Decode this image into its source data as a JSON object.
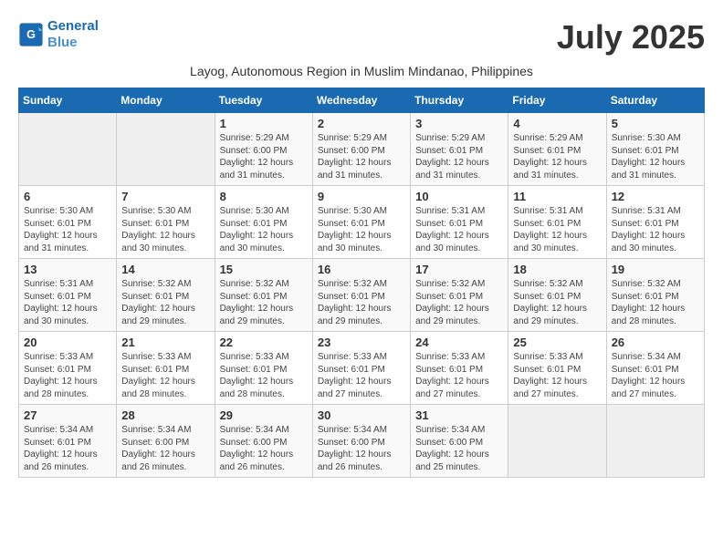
{
  "header": {
    "logo_line1": "General",
    "logo_line2": "Blue",
    "month_year": "July 2025",
    "subtitle": "Layog, Autonomous Region in Muslim Mindanao, Philippines"
  },
  "weekdays": [
    "Sunday",
    "Monday",
    "Tuesday",
    "Wednesday",
    "Thursday",
    "Friday",
    "Saturday"
  ],
  "weeks": [
    [
      {
        "day": "",
        "info": ""
      },
      {
        "day": "",
        "info": ""
      },
      {
        "day": "1",
        "info": "Sunrise: 5:29 AM\nSunset: 6:00 PM\nDaylight: 12 hours and 31 minutes."
      },
      {
        "day": "2",
        "info": "Sunrise: 5:29 AM\nSunset: 6:00 PM\nDaylight: 12 hours and 31 minutes."
      },
      {
        "day": "3",
        "info": "Sunrise: 5:29 AM\nSunset: 6:01 PM\nDaylight: 12 hours and 31 minutes."
      },
      {
        "day": "4",
        "info": "Sunrise: 5:29 AM\nSunset: 6:01 PM\nDaylight: 12 hours and 31 minutes."
      },
      {
        "day": "5",
        "info": "Sunrise: 5:30 AM\nSunset: 6:01 PM\nDaylight: 12 hours and 31 minutes."
      }
    ],
    [
      {
        "day": "6",
        "info": "Sunrise: 5:30 AM\nSunset: 6:01 PM\nDaylight: 12 hours and 31 minutes."
      },
      {
        "day": "7",
        "info": "Sunrise: 5:30 AM\nSunset: 6:01 PM\nDaylight: 12 hours and 30 minutes."
      },
      {
        "day": "8",
        "info": "Sunrise: 5:30 AM\nSunset: 6:01 PM\nDaylight: 12 hours and 30 minutes."
      },
      {
        "day": "9",
        "info": "Sunrise: 5:30 AM\nSunset: 6:01 PM\nDaylight: 12 hours and 30 minutes."
      },
      {
        "day": "10",
        "info": "Sunrise: 5:31 AM\nSunset: 6:01 PM\nDaylight: 12 hours and 30 minutes."
      },
      {
        "day": "11",
        "info": "Sunrise: 5:31 AM\nSunset: 6:01 PM\nDaylight: 12 hours and 30 minutes."
      },
      {
        "day": "12",
        "info": "Sunrise: 5:31 AM\nSunset: 6:01 PM\nDaylight: 12 hours and 30 minutes."
      }
    ],
    [
      {
        "day": "13",
        "info": "Sunrise: 5:31 AM\nSunset: 6:01 PM\nDaylight: 12 hours and 30 minutes."
      },
      {
        "day": "14",
        "info": "Sunrise: 5:32 AM\nSunset: 6:01 PM\nDaylight: 12 hours and 29 minutes."
      },
      {
        "day": "15",
        "info": "Sunrise: 5:32 AM\nSunset: 6:01 PM\nDaylight: 12 hours and 29 minutes."
      },
      {
        "day": "16",
        "info": "Sunrise: 5:32 AM\nSunset: 6:01 PM\nDaylight: 12 hours and 29 minutes."
      },
      {
        "day": "17",
        "info": "Sunrise: 5:32 AM\nSunset: 6:01 PM\nDaylight: 12 hours and 29 minutes."
      },
      {
        "day": "18",
        "info": "Sunrise: 5:32 AM\nSunset: 6:01 PM\nDaylight: 12 hours and 29 minutes."
      },
      {
        "day": "19",
        "info": "Sunrise: 5:32 AM\nSunset: 6:01 PM\nDaylight: 12 hours and 28 minutes."
      }
    ],
    [
      {
        "day": "20",
        "info": "Sunrise: 5:33 AM\nSunset: 6:01 PM\nDaylight: 12 hours and 28 minutes."
      },
      {
        "day": "21",
        "info": "Sunrise: 5:33 AM\nSunset: 6:01 PM\nDaylight: 12 hours and 28 minutes."
      },
      {
        "day": "22",
        "info": "Sunrise: 5:33 AM\nSunset: 6:01 PM\nDaylight: 12 hours and 28 minutes."
      },
      {
        "day": "23",
        "info": "Sunrise: 5:33 AM\nSunset: 6:01 PM\nDaylight: 12 hours and 27 minutes."
      },
      {
        "day": "24",
        "info": "Sunrise: 5:33 AM\nSunset: 6:01 PM\nDaylight: 12 hours and 27 minutes."
      },
      {
        "day": "25",
        "info": "Sunrise: 5:33 AM\nSunset: 6:01 PM\nDaylight: 12 hours and 27 minutes."
      },
      {
        "day": "26",
        "info": "Sunrise: 5:34 AM\nSunset: 6:01 PM\nDaylight: 12 hours and 27 minutes."
      }
    ],
    [
      {
        "day": "27",
        "info": "Sunrise: 5:34 AM\nSunset: 6:01 PM\nDaylight: 12 hours and 26 minutes."
      },
      {
        "day": "28",
        "info": "Sunrise: 5:34 AM\nSunset: 6:00 PM\nDaylight: 12 hours and 26 minutes."
      },
      {
        "day": "29",
        "info": "Sunrise: 5:34 AM\nSunset: 6:00 PM\nDaylight: 12 hours and 26 minutes."
      },
      {
        "day": "30",
        "info": "Sunrise: 5:34 AM\nSunset: 6:00 PM\nDaylight: 12 hours and 26 minutes."
      },
      {
        "day": "31",
        "info": "Sunrise: 5:34 AM\nSunset: 6:00 PM\nDaylight: 12 hours and 25 minutes."
      },
      {
        "day": "",
        "info": ""
      },
      {
        "day": "",
        "info": ""
      }
    ]
  ]
}
